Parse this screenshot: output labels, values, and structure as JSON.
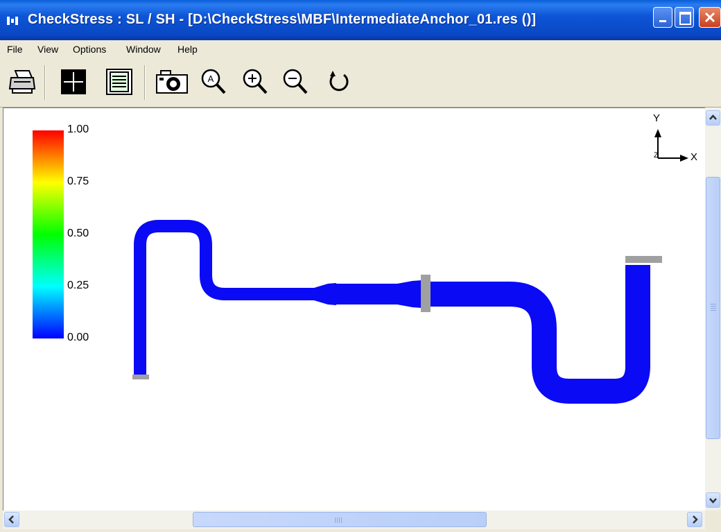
{
  "window": {
    "title": "CheckStress : SL / SH -  [D:\\CheckStress\\MBF\\IntermediateAnchor_01.res ()]",
    "controls": {
      "minimize": "minimize",
      "maximize": "maximize",
      "close": "close"
    }
  },
  "menu": {
    "items": [
      "File",
      "View",
      "Options",
      "Window",
      "Help"
    ]
  },
  "toolbar": {
    "buttons": [
      "print-icon",
      "crosshair-icon",
      "report-icon",
      "camera-icon",
      "zoom-auto-icon",
      "zoom-in-icon",
      "zoom-out-icon",
      "rotate-icon"
    ]
  },
  "legend": {
    "labels": [
      "1.00",
      "0.75",
      "0.50",
      "0.25",
      "0.00"
    ],
    "colors": [
      "#ff0000",
      "#ffff00",
      "#00ff00",
      "#00ffff",
      "#0000ff"
    ]
  },
  "axes": {
    "y": "Y",
    "x": "X",
    "z": "Z"
  },
  "colors": {
    "pipe": "#0a0af5",
    "support": "#a0a0a0",
    "titlebar": "#0a48c4"
  }
}
